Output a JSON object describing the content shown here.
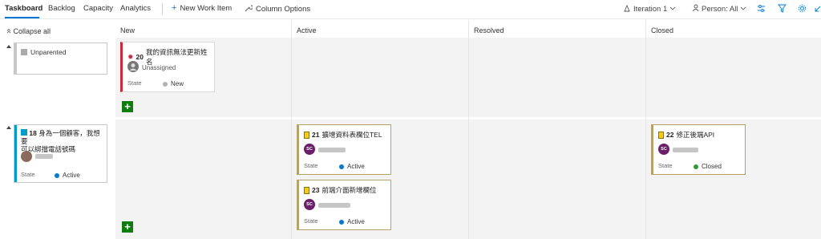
{
  "tabs": [
    "Taskboard",
    "Backlog",
    "Capacity",
    "Analytics"
  ],
  "toolbar": {
    "new_work_item": "New Work Item",
    "column_options": "Column Options",
    "iteration": "Iteration 1",
    "person": "Person: All"
  },
  "collapse_all": "Collapse all",
  "columns": [
    "New",
    "Active",
    "Resolved",
    "Closed"
  ],
  "unparented": "Unparented",
  "story": {
    "id": "18",
    "title_line1": "身為一個顧客，我想要",
    "title_line2": "可以綁擋電話號碼",
    "state_label": "State",
    "state": "Active"
  },
  "cards": {
    "bug20": {
      "id": "20",
      "title": "我的資訊無法更新姓名",
      "assignee": "Unassigned",
      "state_label": "State",
      "state": "New"
    },
    "task21": {
      "id": "21",
      "title": "擴增資料表欄位TEL",
      "avatar": "SC",
      "state_label": "State",
      "state": "Active"
    },
    "task23": {
      "id": "23",
      "title": "前端介面新增欄位",
      "avatar": "SC",
      "state_label": "State",
      "state": "Active"
    },
    "task22": {
      "id": "22",
      "title": "修正後端API",
      "avatar": "SC",
      "state_label": "State",
      "state": "Closed"
    }
  },
  "colors": {
    "accent": "#0078d4",
    "bug": "#cc293d",
    "task": "#b7a26a",
    "active": "#007acc",
    "closed": "#339933",
    "new": "#b2b2b2",
    "add": "#107c10"
  }
}
